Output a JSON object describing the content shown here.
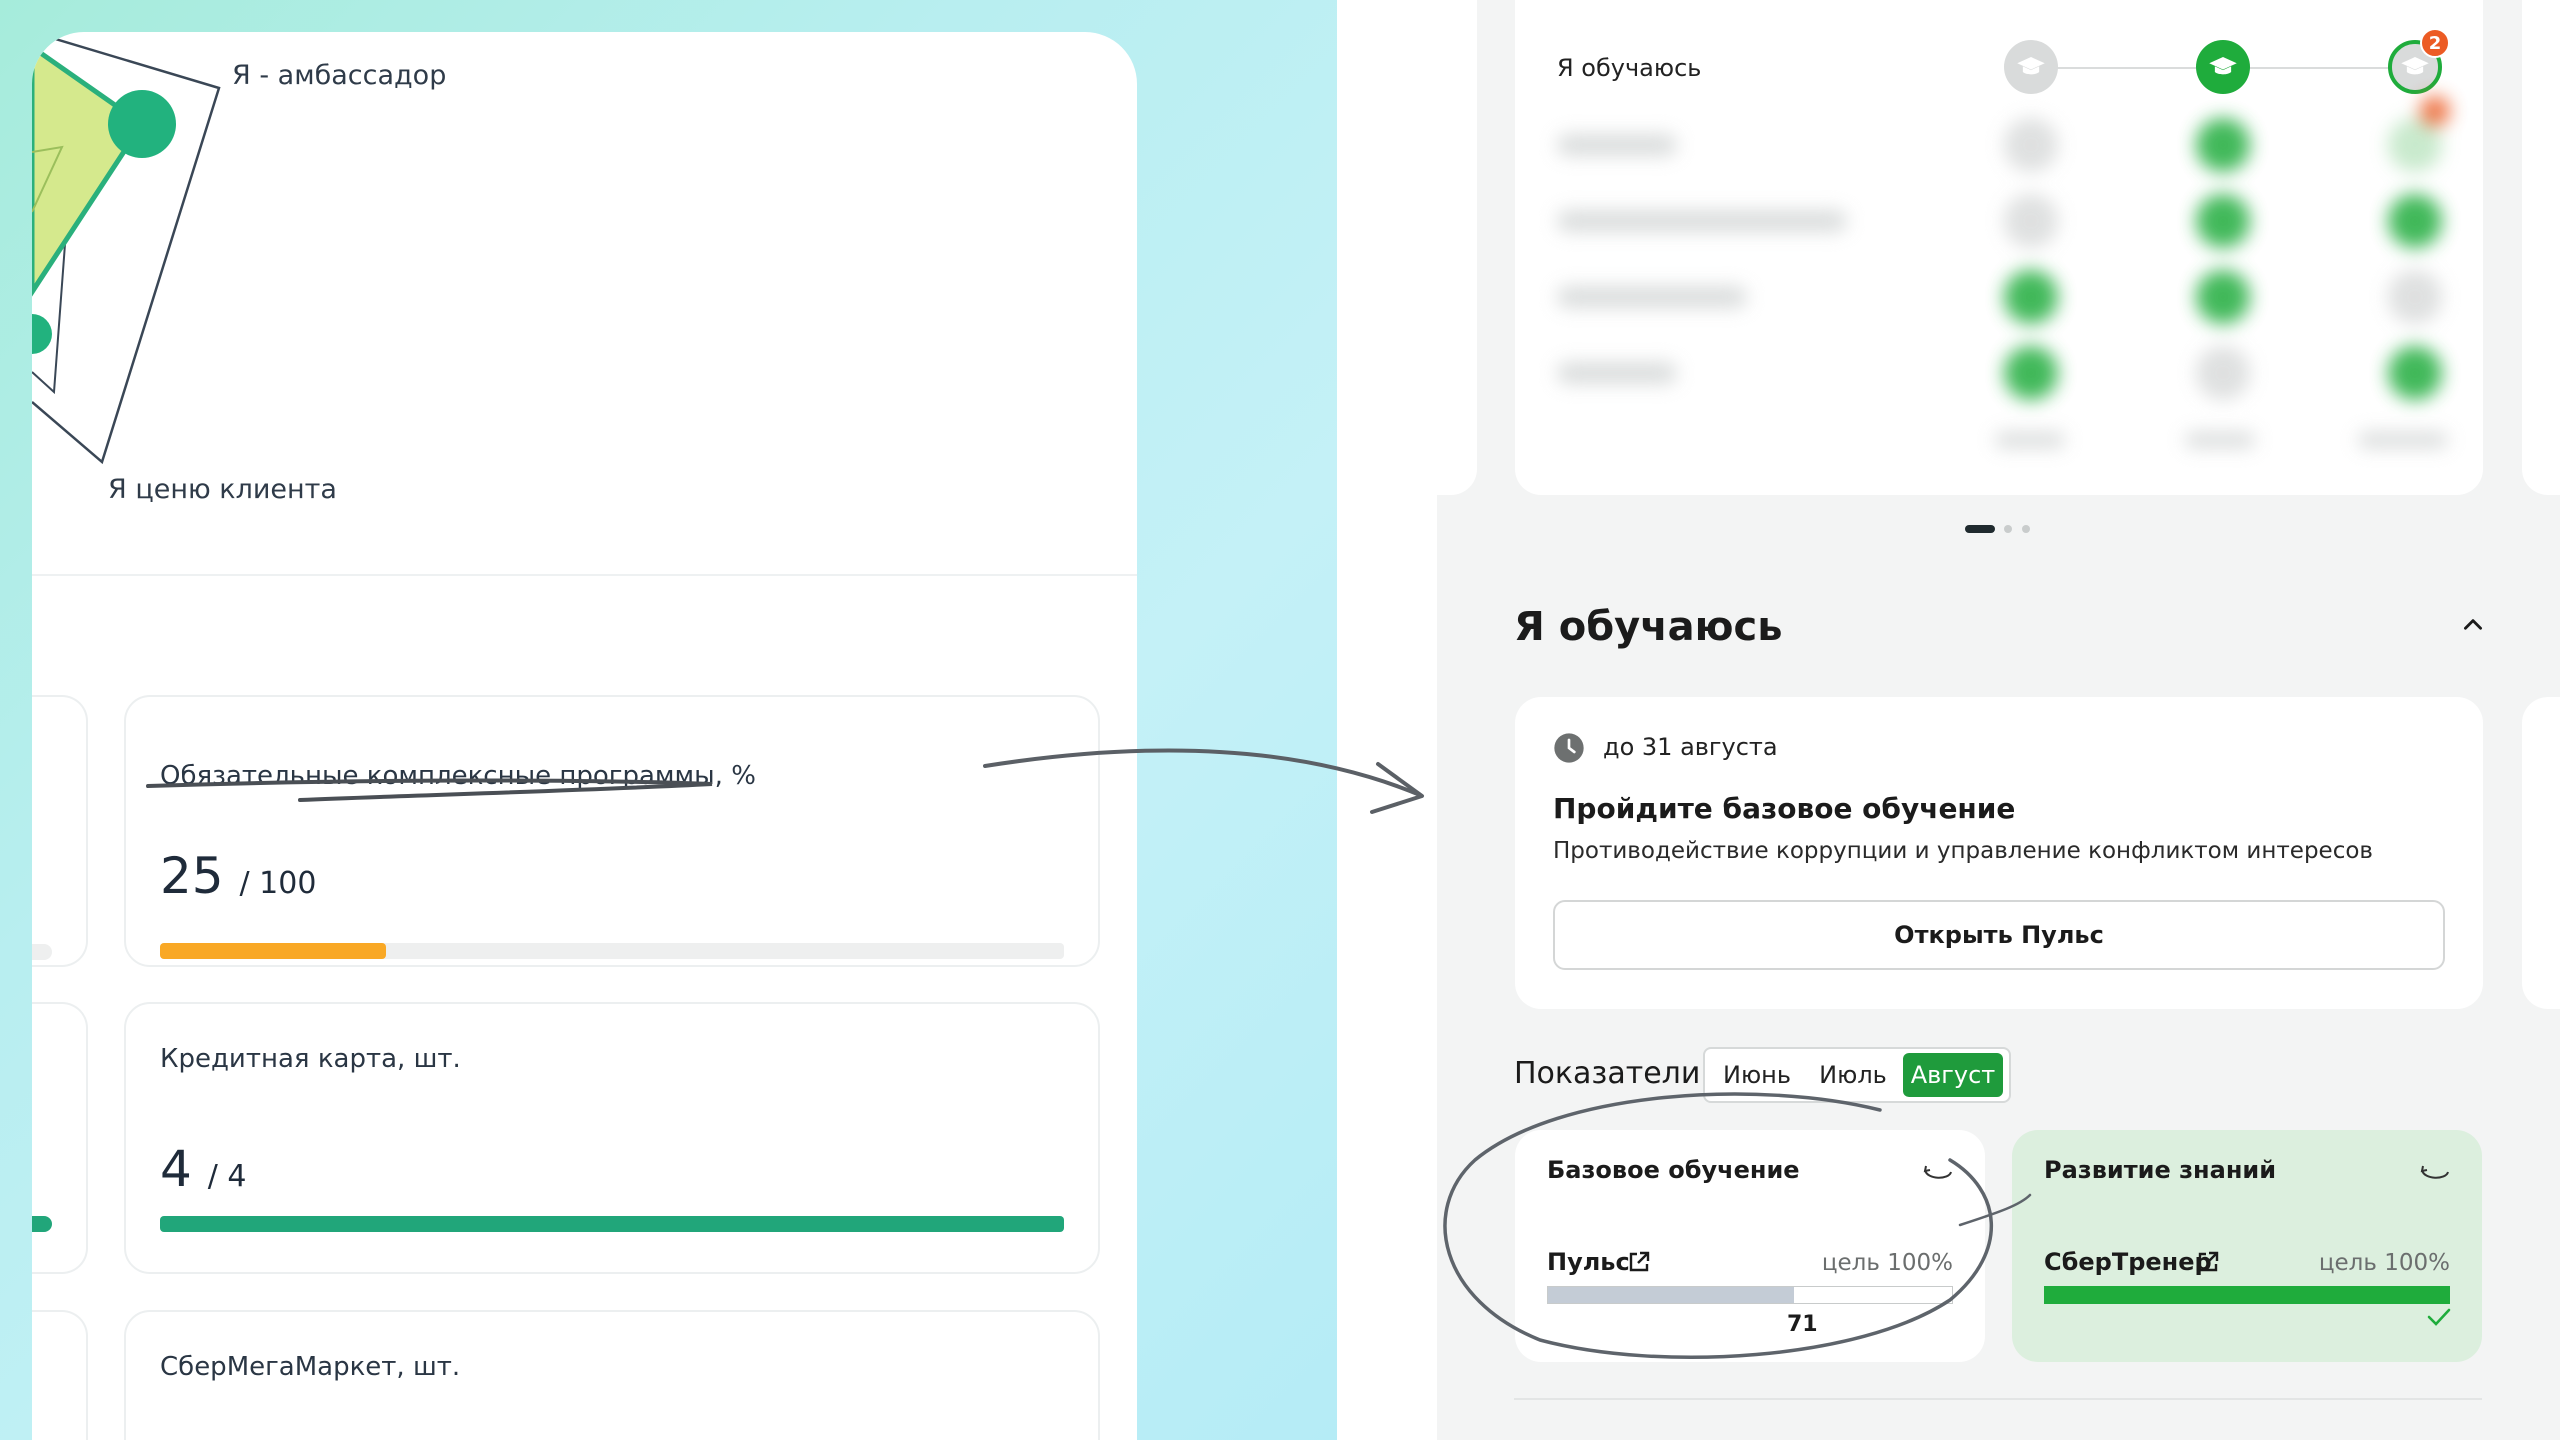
{
  "radar": {
    "label_ambassador": "Я - амбассадор",
    "label_client": "Я ценю клиента"
  },
  "metrics": [
    {
      "title": "Обязательные комплексные программы, %",
      "value": "25",
      "total": "/ 100",
      "progress": 0.25,
      "color": "#f9a825"
    },
    {
      "title": "Кредитная карта, шт.",
      "value": "4",
      "total": "/ 4",
      "progress": 1.0,
      "color": "#21a67a"
    },
    {
      "title": "СберМегаМаркет, шт.",
      "value": "",
      "total": "",
      "progress": 0,
      "color": "#21a67a"
    }
  ],
  "progress_card": {
    "title": "Я обучаюсь",
    "badge": "2"
  },
  "section": {
    "title": "Я обучаюсь"
  },
  "task": {
    "deadline": "до 31 августа",
    "title": "Пройдите базовое обучение",
    "subtitle": "Противодействие коррупции и управление конфликтом интересов",
    "button": "Открыть Пульс"
  },
  "indicators": {
    "label": "Показатели",
    "months": [
      "Июнь",
      "Июль",
      "Август"
    ],
    "active_month": "Август",
    "cards": [
      {
        "title": "Базовое обучение",
        "name": "Пульс",
        "goal": "цель 100%",
        "value": "71",
        "progress": 0.61,
        "color": "#c4ccd6",
        "done": false
      },
      {
        "title": "Развитие знаний",
        "name": "СберТренер",
        "goal": "цель 100%",
        "value": "",
        "progress": 1.0,
        "color": "#1fac3c",
        "done": true
      }
    ]
  },
  "colors": {
    "accent_green": "#1f9b3c",
    "teal": "#21a67a",
    "orange": "#f9a825",
    "badge_red": "#ec5b24"
  }
}
